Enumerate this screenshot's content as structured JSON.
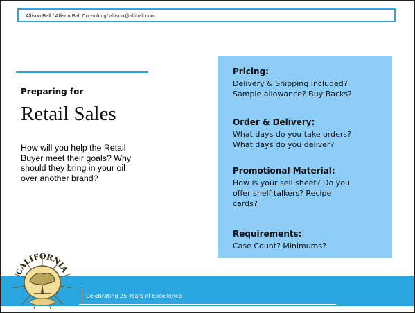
{
  "header": {
    "contact": "Allison Ball / Allison Ball Consulting/ allison@alliball.com"
  },
  "title_block": {
    "kicker": "Preparing for",
    "title": "Retail Sales",
    "lead_lines": [
      "How will you help the Retail",
      "Buyer meet their goals? Why",
      "should they bring in your oil",
      "over another brand?"
    ]
  },
  "panel": {
    "color": "#8ecdf7",
    "sections": [
      {
        "title": "Pricing:",
        "lines": [
          "Delivery & Shipping Included?",
          "Sample allowance? Buy Backs?"
        ]
      },
      {
        "title": "Order & Delivery:",
        "lines": [
          "What days do you take orders?",
          "What days do you deliver?"
        ]
      },
      {
        "title": "Promotional Material:",
        "lines": [
          "How is your sell sheet? Do you",
          "offer shelf talkers? Recipe",
          "cards?"
        ]
      },
      {
        "title": "Requirements:",
        "lines": [
          "Case Count? Minimums?"
        ]
      }
    ]
  },
  "footer": {
    "tagline": "Celebrating 25 Years of Excellence",
    "band_color": "#29a6df"
  },
  "seal": {
    "icon": "california-olive-oil-seal-icon",
    "text": "CALIFORNIA"
  }
}
